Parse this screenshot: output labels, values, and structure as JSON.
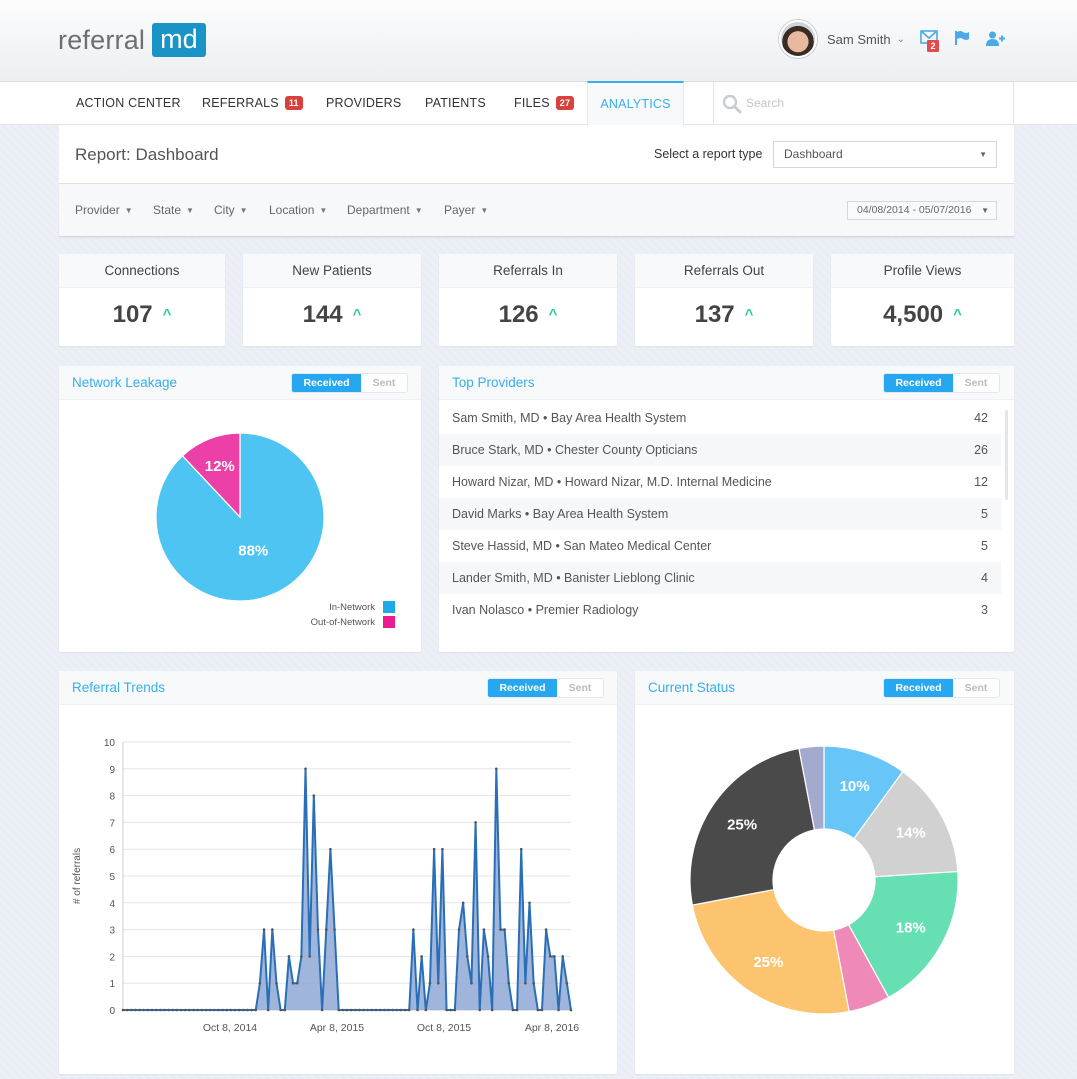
{
  "header": {
    "logo_text": "referral",
    "logo_badge": "md",
    "user_name": "Sam Smith",
    "mail_count": "2",
    "icons": [
      "mail-icon",
      "flag-icon",
      "add-user-icon"
    ]
  },
  "nav": {
    "items": [
      {
        "label": "ACTION CENTER",
        "badge": null
      },
      {
        "label": "REFERRALS",
        "badge": "11"
      },
      {
        "label": "PROVIDERS",
        "badge": null
      },
      {
        "label": "PATIENTS",
        "badge": null
      },
      {
        "label": "FILES",
        "badge": "27"
      },
      {
        "label": "ANALYTICS",
        "badge": null,
        "active": true
      }
    ],
    "search_placeholder": "Search"
  },
  "report": {
    "title": "Report: Dashboard",
    "type_label": "Select a report type",
    "type_value": "Dashboard"
  },
  "filters": {
    "items": [
      "Provider",
      "State",
      "City",
      "Location",
      "Department",
      "Payer"
    ],
    "date_range": "04/08/2014 - 05/07/2016"
  },
  "stats": [
    {
      "label": "Connections",
      "value": "107",
      "trend": "up"
    },
    {
      "label": "New Patients",
      "value": "144",
      "trend": "up"
    },
    {
      "label": "Referrals In",
      "value": "126",
      "trend": "up"
    },
    {
      "label": "Referrals Out",
      "value": "137",
      "trend": "up"
    },
    {
      "label": "Profile Views",
      "value": "4,500",
      "trend": "up"
    }
  ],
  "toggle": {
    "received": "Received",
    "sent": "Sent"
  },
  "network_leakage": {
    "title": "Network Leakage",
    "selected": "Received"
  },
  "top_providers": {
    "title": "Top Providers",
    "selected": "Received",
    "rows": [
      {
        "name": "Sam Smith, MD • Bay Area Health System",
        "count": "42"
      },
      {
        "name": "Bruce Stark, MD • Chester County Opticians",
        "count": "26"
      },
      {
        "name": "Howard Nizar, MD • Howard Nizar, M.D. Internal Medicine",
        "count": "12"
      },
      {
        "name": "David Marks • Bay Area Health System",
        "count": "5"
      },
      {
        "name": "Steve Hassid, MD • San Mateo Medical Center",
        "count": "5"
      },
      {
        "name": "Lander Smith, MD • Banister Lieblong Clinic",
        "count": "4"
      },
      {
        "name": "Ivan Nolasco • Premier Radiology",
        "count": "3"
      }
    ]
  },
  "referral_trends": {
    "title": "Referral Trends",
    "selected": "Received"
  },
  "current_status": {
    "title": "Current Status",
    "selected": "Received"
  },
  "chart_data": [
    {
      "id": "network-leakage",
      "type": "pie",
      "title": "Network Leakage",
      "slices": [
        {
          "label": "In-Network",
          "value": 88,
          "display": "88%",
          "color": "#4dc4f2"
        },
        {
          "label": "Out-of-Network",
          "value": 12,
          "display": "12%",
          "color": "#ec3fa7"
        }
      ],
      "legend": "bottom-right"
    },
    {
      "id": "referral-trends",
      "type": "area",
      "title": "Referral Trends",
      "xlabel": "",
      "ylabel": "# of referrals",
      "ylim": [
        0,
        10
      ],
      "yticks": [
        0,
        1,
        2,
        3,
        4,
        5,
        6,
        7,
        8,
        9,
        10
      ],
      "xticks": [
        "Oct 8, 2014",
        "Apr 8, 2015",
        "Oct 8, 2015",
        "Apr 8, 2016"
      ],
      "grid": true,
      "line_color": "#2a6fb5",
      "fill_color": "#8fa8d6",
      "values": [
        0,
        0,
        0,
        0,
        0,
        0,
        0,
        0,
        0,
        0,
        0,
        0,
        0,
        0,
        0,
        0,
        0,
        0,
        0,
        0,
        0,
        0,
        0,
        0,
        0,
        0,
        0,
        0,
        0,
        0,
        0,
        0,
        0,
        1,
        3,
        0,
        3,
        1,
        0,
        0,
        2,
        1,
        1,
        2,
        9,
        2,
        8,
        3,
        0,
        3,
        6,
        3,
        0,
        0,
        0,
        0,
        0,
        0,
        0,
        0,
        0,
        0,
        0,
        0,
        0,
        0,
        0,
        0,
        0,
        0,
        3,
        0,
        2,
        0,
        1,
        6,
        1,
        6,
        0,
        0,
        0,
        3,
        4,
        2,
        1,
        7,
        0,
        3,
        2,
        0,
        9,
        3,
        3,
        1,
        0,
        0,
        6,
        1,
        4,
        1,
        0,
        0,
        3,
        2,
        2,
        0,
        2,
        1,
        0
      ]
    },
    {
      "id": "current-status",
      "type": "pie",
      "donut": true,
      "title": "Current Status",
      "slices": [
        {
          "label": "",
          "value": 10,
          "display": "10%",
          "color": "#67c6f7"
        },
        {
          "label": "",
          "value": 14,
          "display": "14%",
          "color": "#d1d1d1"
        },
        {
          "label": "",
          "value": 18,
          "display": "18%",
          "color": "#66dfb2"
        },
        {
          "label": "",
          "value": 5,
          "display": "",
          "color": "#ef89b8"
        },
        {
          "label": "",
          "value": 25,
          "display": "25%",
          "color": "#fcc46e"
        },
        {
          "label": "",
          "value": 25,
          "display": "25%",
          "color": "#4a4a4a"
        },
        {
          "label": "",
          "value": 3,
          "display": "",
          "color": "#a3aace"
        }
      ]
    }
  ]
}
